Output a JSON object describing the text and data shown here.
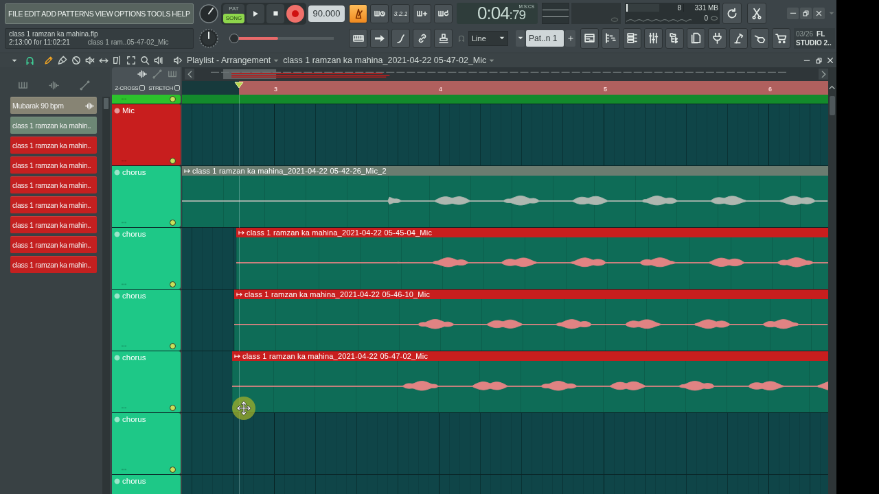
{
  "menu": [
    "FILE",
    "EDIT",
    "ADD",
    "PATTERNS",
    "VIEW",
    "OPTIONS",
    "TOOLS",
    "HELP"
  ],
  "transport": {
    "modes": [
      {
        "label": "PAT",
        "selected": false
      },
      {
        "label": "SONG",
        "selected": true
      }
    ],
    "recording": true,
    "tempo": "90.000"
  },
  "record_options": [
    {
      "kind": "metronome",
      "on": true
    },
    {
      "kind": "wait",
      "on": false
    },
    {
      "kind": "countdown",
      "label": "3.2.1",
      "on": false
    },
    {
      "kind": "step",
      "on": false
    },
    {
      "kind": "loop",
      "on": false
    }
  ],
  "clock": {
    "time": "0:04",
    "fraction": ":79",
    "unit": "M:S:CS"
  },
  "monitor": {
    "level": 0.05,
    "cpu": "8",
    "memory": "331 MB",
    "polyphony": "0"
  },
  "info": {
    "file": "class 1 ramzan ka mahina.flp",
    "time": "2:13:00 for 11:02:21",
    "hint": "class 1 ram..05-47-02_Mic"
  },
  "song_position": {
    "level": 0.47
  },
  "snap": {
    "value": "Line"
  },
  "pattern": {
    "value": "Pat..n 1"
  },
  "news": {
    "date": "03/26",
    "title": "FL",
    "subtitle": "STUDIO 2.."
  },
  "playlist": {
    "snap": {
      "on": true
    },
    "tools": [
      {
        "kind": "pencil",
        "selected": true
      },
      {
        "kind": "brush",
        "selected": false
      },
      {
        "kind": "delete",
        "selected": false
      },
      {
        "kind": "mute",
        "selected": false
      },
      {
        "kind": "slip",
        "selected": false
      },
      {
        "kind": "slice",
        "selected": false
      },
      {
        "kind": "select",
        "selected": false
      },
      {
        "kind": "zoom",
        "selected": false
      },
      {
        "kind": "playback",
        "selected": false
      }
    ],
    "title": "Playlist - Arrangement",
    "pattern": "class 1 ramzan ka mahina_2021-04-22 05-47-02_Mic",
    "options": [
      {
        "label": "Z-CROSS",
        "checked": false
      },
      {
        "label": "STRETCH",
        "checked": false
      }
    ],
    "ruler": [
      "3",
      "4",
      "5",
      "6"
    ]
  },
  "clip_sources": [
    {
      "label": "Mubarak 90 bpm",
      "kind": "sample",
      "color": "#878474"
    },
    {
      "label": "class 1 ramzan ka mahin..",
      "kind": "clip",
      "color": "#6d8775"
    },
    {
      "label": "class 1 ramzan ka mahin..",
      "kind": "clip",
      "color": "#c42020"
    },
    {
      "label": "class 1 ramzan ka mahin..",
      "kind": "clip",
      "color": "#c42020"
    },
    {
      "label": "class 1 ramzan ka mahin..",
      "kind": "clip",
      "color": "#c42020"
    },
    {
      "label": "class 1 ramzan ka mahin..",
      "kind": "clip",
      "color": "#c42020"
    },
    {
      "label": "class 1 ramzan ka mahin..",
      "kind": "clip",
      "color": "#c42020"
    },
    {
      "label": "class 1 ramzan ka mahin..",
      "kind": "clip",
      "color": "#c42020"
    },
    {
      "label": "class 1 ramzan ka mahin..",
      "kind": "clip",
      "color": "#c42020"
    }
  ],
  "tracks": [
    {
      "color": "#2cc22c",
      "clip": {
        "color": "#138a2c"
      }
    },
    {
      "name": "Mic",
      "color": "#c81e1e"
    },
    {
      "name": "chorus",
      "color": "#1ec887",
      "clip": {
        "name": "class 1 ramzan ka mahina_2021-04-22 05-42-26_Mic_2",
        "color": "#6b7c70"
      }
    },
    {
      "name": "chorus",
      "color": "#1ec887",
      "clip": {
        "name": "class 1 ramzan ka mahina_2021-04-22 05-45-04_Mic",
        "color": "#c81e1e"
      }
    },
    {
      "name": "chorus",
      "color": "#1ec887",
      "clip": {
        "name": "class 1 ramzan ka mahina_2021-04-22 05-46-10_Mic",
        "color": "#c81e1e"
      }
    },
    {
      "name": "chorus",
      "color": "#1ec887",
      "clip": {
        "name": "class 1 ramzan ka mahina_2021-04-22 05-47-02_Mic",
        "color": "#c81e1e"
      }
    },
    {
      "name": "chorus",
      "color": "#1ec887"
    },
    {
      "name": "chorus",
      "color": "#1ec887"
    }
  ]
}
